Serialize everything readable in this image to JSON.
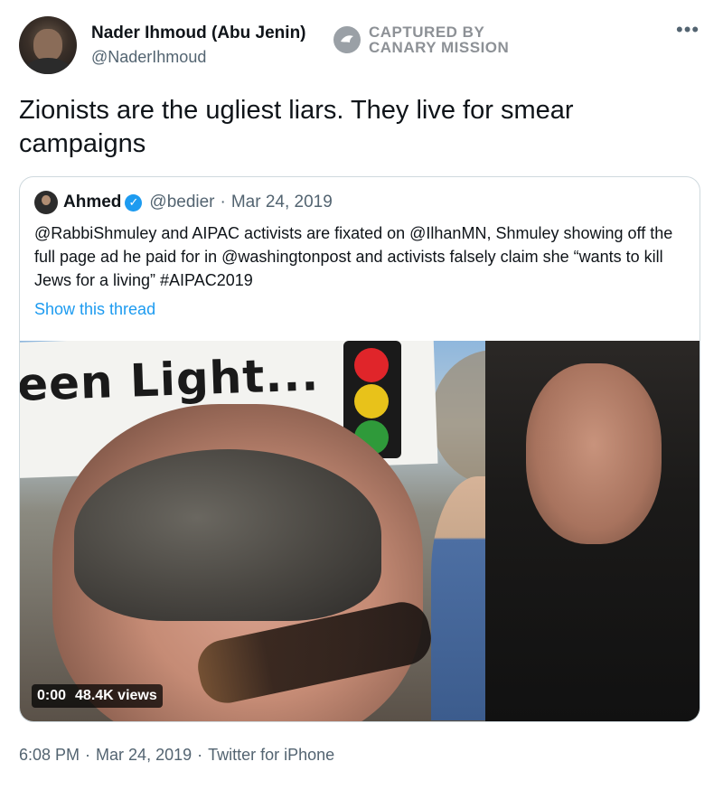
{
  "author": {
    "name": "Nader Ihmoud (Abu Jenin)",
    "handle": "@NaderIhmoud"
  },
  "watermark": {
    "line1": "CAPTURED BY",
    "line2": "CANARY MISSION"
  },
  "more_icon": "ellipsis-icon",
  "tweet_text": "Zionists are the ugliest liars. They live for smear campaigns",
  "quoted": {
    "name": "Ahmed",
    "verified_icon": "verified-badge-icon",
    "handle": "@bedier",
    "separator": "·",
    "date": "Mar 24, 2019",
    "text": "@RabbiShmuley and AIPAC activists are fixated on @IlhanMN, Shmuley showing off the full page ad he paid for in @washingtonpost and activists falsely claim she “wants to kill Jews for a living” #AIPAC2019",
    "show_thread": "Show this thread",
    "video": {
      "time": "0:00",
      "views": "48.4K views"
    }
  },
  "footer": {
    "time": "6:08 PM",
    "sep1": "·",
    "date": "Mar 24, 2019",
    "sep2": "·",
    "source": "Twitter for iPhone"
  },
  "colors": {
    "link": "#1d9bf0",
    "secondary": "#536471",
    "text": "#0f1419",
    "border": "#cfd9de"
  }
}
